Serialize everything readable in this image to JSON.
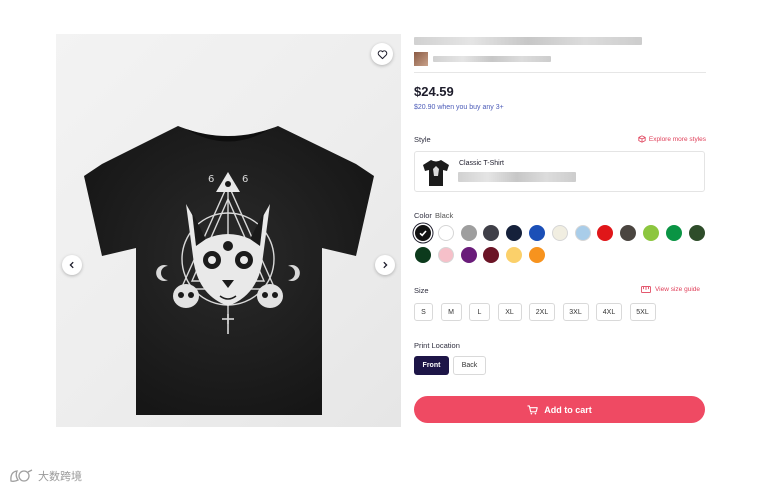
{
  "product": {
    "price": "$24.59",
    "bulk_offer": "$20.90 when you buy any 3+"
  },
  "style_section": {
    "label": "Style",
    "explore_link": "Explore more styles",
    "selected_style_name": "Classic T-Shirt"
  },
  "color_section": {
    "label": "Color",
    "selected_value": "Black",
    "swatches": [
      "#111111",
      "#ffffff",
      "#9e9e9e",
      "#3f3f48",
      "#15213b",
      "#1b4fb7",
      "#f1eee1",
      "#a9cde9",
      "#e01619",
      "#4a4540",
      "#8cc63f",
      "#0a9444",
      "#2e4d2a",
      "#0c3a1c",
      "#f6c0c9",
      "#6a1c7a",
      "#6b1426",
      "#fbd06a",
      "#f7931e"
    ]
  },
  "size_section": {
    "label": "Size",
    "guide_link": "View size guide",
    "sizes": [
      "S",
      "M",
      "L",
      "XL",
      "2XL",
      "3XL",
      "4XL",
      "5XL"
    ]
  },
  "print_location": {
    "label": "Print Location",
    "options": [
      "Front",
      "Back"
    ],
    "selected": "Front"
  },
  "cart": {
    "button_label": "Add to cart"
  },
  "watermark": {
    "text": "大数跨境"
  },
  "icons": {
    "favorite": "heart-icon",
    "prev": "chevron-left-icon",
    "next": "chevron-right-icon",
    "explore": "cube-icon",
    "size_guide": "ruler-icon",
    "cart": "cart-icon"
  },
  "colors": {
    "accent": "#ef4a63",
    "link": "#e0405a",
    "bulk_text": "#4b5bb8",
    "selected_location": "#1d1547"
  }
}
